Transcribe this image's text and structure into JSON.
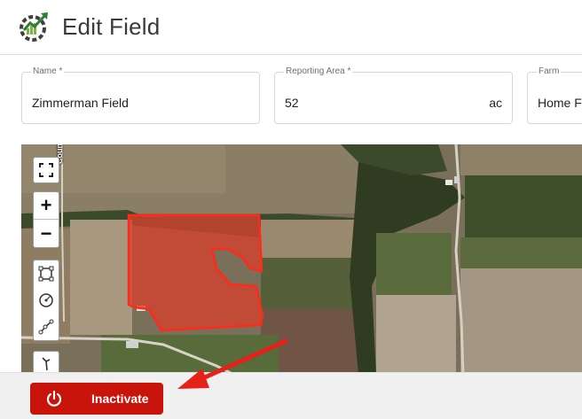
{
  "header": {
    "title": "Edit Field",
    "logo_icon": "gear-check-growth-logo"
  },
  "form": {
    "name": {
      "label": "Name *",
      "value": "Zimmerman Field"
    },
    "reporting_area": {
      "label": "Reporting Area *",
      "value": "52",
      "unit": "ac"
    },
    "farm": {
      "label": "Farm",
      "value": "Home Fa"
    }
  },
  "map": {
    "controls": {
      "fullscreen_icon": "fullscreen-icon",
      "zoom_in": "+",
      "zoom_out": "−",
      "draw_tools": [
        "draw-rectangle-icon",
        "draw-circle-icon",
        "draw-line-icon",
        "draw-freehand-icon"
      ]
    },
    "road_labels": [
      "County R"
    ],
    "field_boundary_color": "#ff2a1a"
  },
  "footer": {
    "inactivate_label": "Inactivate",
    "inactivate_icon": "power-icon",
    "button_color": "#c9140c"
  },
  "annotation": {
    "arrow_color": "#e8201a"
  }
}
